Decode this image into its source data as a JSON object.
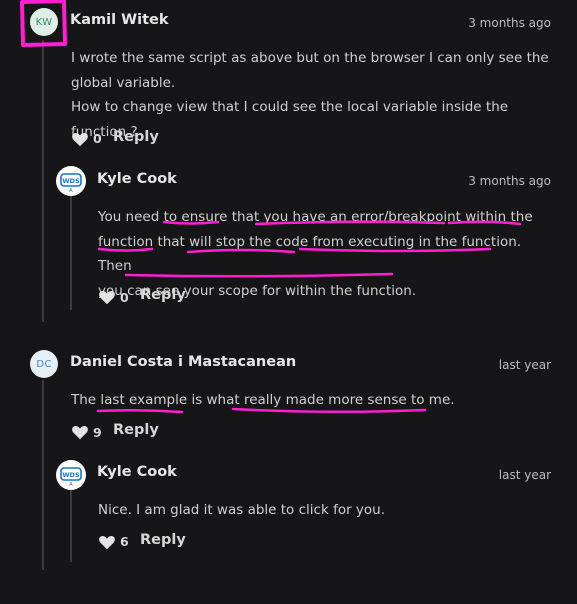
{
  "comments": [
    {
      "author": "Kamil Witek",
      "initials": "KW",
      "time": "3 months ago",
      "text_lines": [
        "I wrote the same script as above but on the browser I can only see the",
        "global variable.",
        "How to change view that I could see the local variable inside the function ?"
      ],
      "likes": "0",
      "reply_label": "Reply",
      "replies": [
        {
          "author": "Kyle Cook",
          "logo_text": "WDS",
          "time": "3 months ago",
          "text_lines": [
            "You need to ensure that you have an error/breakpoint within the",
            "function that will stop the code from executing in the function. Then",
            "you can see your scope for within the function."
          ],
          "likes": "0",
          "reply_label": "Reply"
        }
      ]
    },
    {
      "author": "Daniel Costa i Mastacanean",
      "initials": "DC",
      "time": "last year",
      "text_lines": [
        "The last example is what really made more sense to me."
      ],
      "likes": "9",
      "reply_label": "Reply",
      "replies": [
        {
          "author": "Kyle Cook",
          "logo_text": "WDS",
          "time": "last year",
          "text_lines": [
            "Nice. I am glad it was able to click for you."
          ],
          "likes": "6",
          "reply_label": "Reply"
        }
      ]
    }
  ],
  "colors": {
    "background": "#161618",
    "annotation": "#ff1fd2",
    "kw_avatar_bg": "#dfeee6",
    "kw_avatar_text": "#3b8f63",
    "dc_avatar_bg": "#e6f0f7",
    "dc_avatar_text": "#4c87b4"
  }
}
